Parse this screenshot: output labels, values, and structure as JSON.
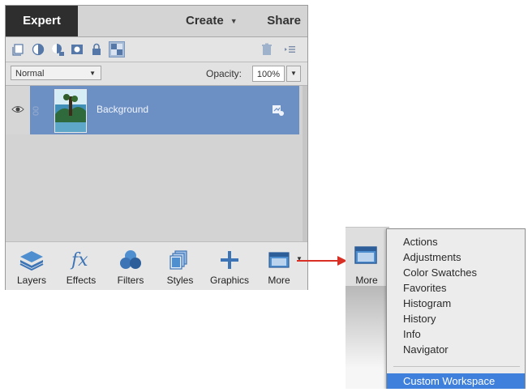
{
  "header": {
    "active_tab": "Expert",
    "create_label": "Create",
    "share_label": "Share"
  },
  "toolbar": {
    "icons": [
      "new-layer-icon",
      "fill-layer-icon",
      "adjustment-layer-icon",
      "layer-mask-icon",
      "lock-all-icon",
      "lock-transparency-icon",
      "delete-layer-icon",
      "panel-options-icon"
    ]
  },
  "blend": {
    "mode": "Normal",
    "opacity_label": "Opacity:",
    "opacity_value": "100%"
  },
  "layers": [
    {
      "name": "Background",
      "visible": true,
      "selected": true
    }
  ],
  "bottombar": {
    "items": [
      {
        "label": "Layers",
        "icon": "layers-icon"
      },
      {
        "label": "Effects",
        "icon": "fx-icon"
      },
      {
        "label": "Filters",
        "icon": "filters-icon"
      },
      {
        "label": "Styles",
        "icon": "styles-icon"
      },
      {
        "label": "Graphics",
        "icon": "plus-icon"
      },
      {
        "label": "More",
        "icon": "more-panels-icon"
      }
    ]
  },
  "zoom": {
    "more_label": "More",
    "menu_items": [
      "Actions",
      "Adjustments",
      "Color Swatches",
      "Favorites",
      "Histogram",
      "History",
      "Info",
      "Navigator"
    ],
    "custom_item": "Custom Workspace"
  },
  "colors": {
    "accent": "#3f80dc",
    "selected_layer": "#6c8fc4",
    "arrow": "#d93025",
    "dark_tab": "#2e2e2e"
  }
}
